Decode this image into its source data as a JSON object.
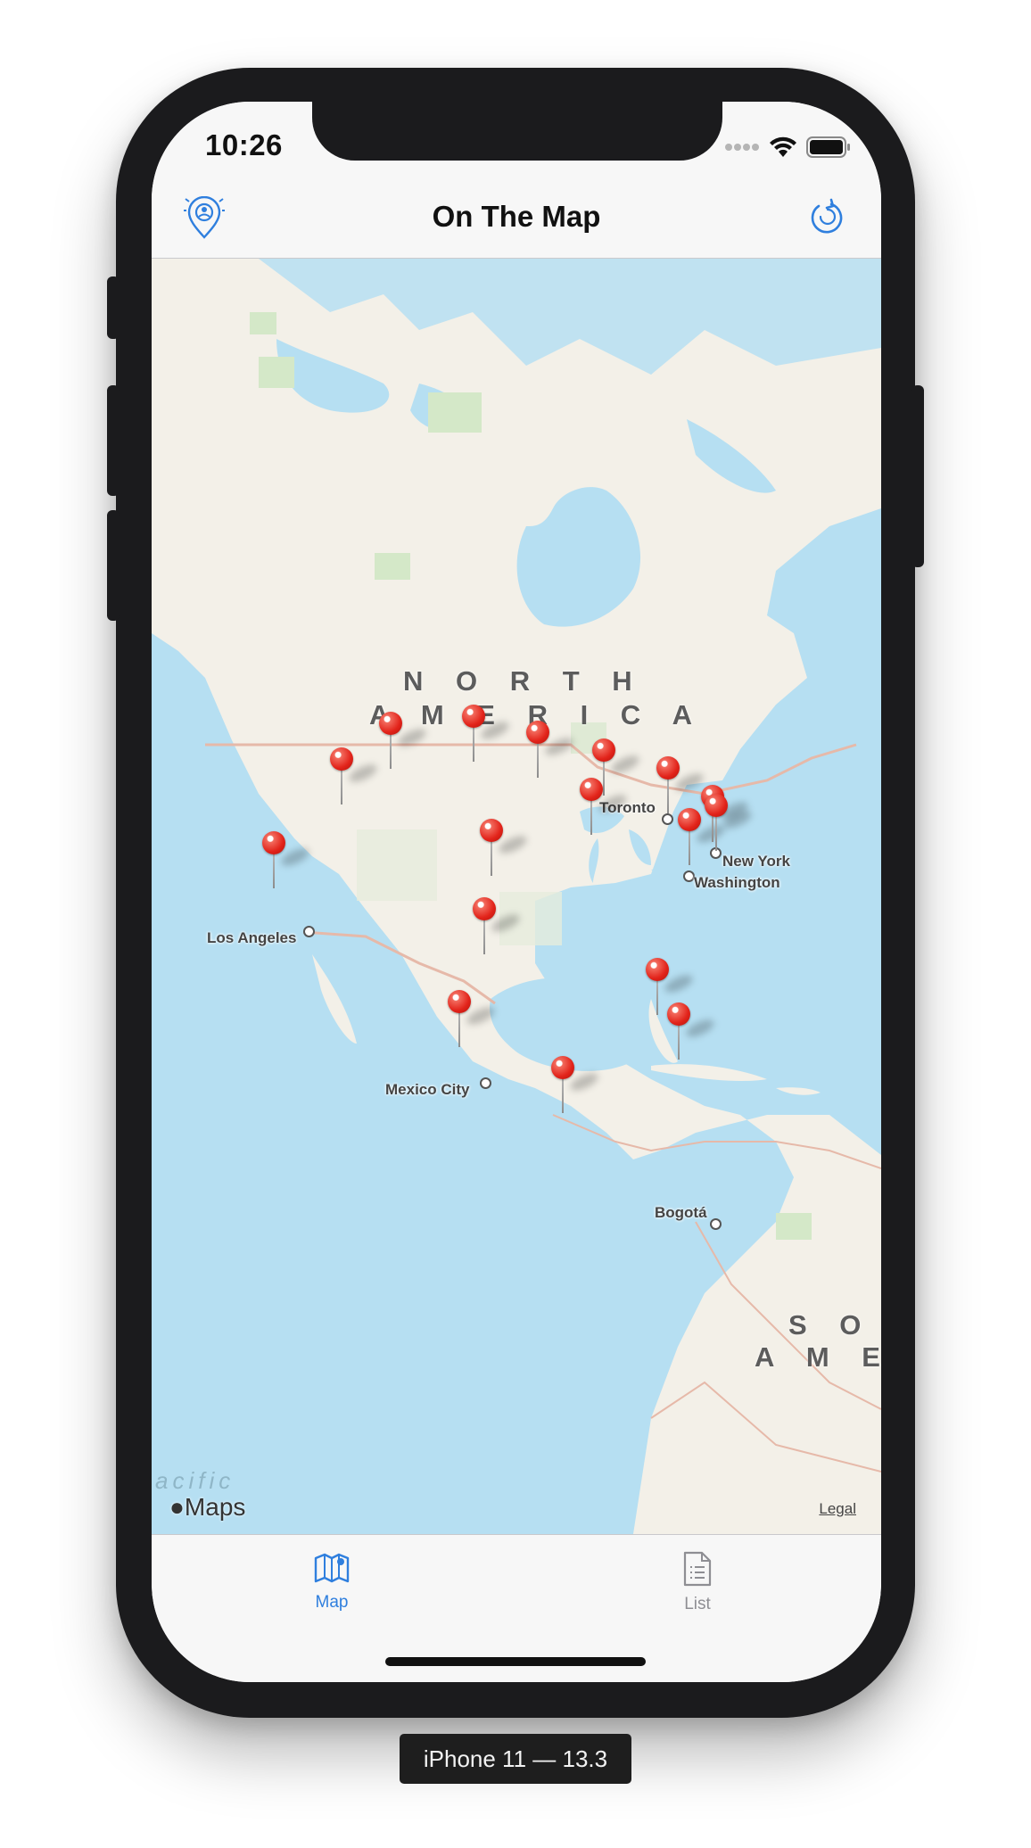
{
  "status_bar": {
    "time": "10:26"
  },
  "nav": {
    "title": "On The Map",
    "left_icon": "location-pin-icon",
    "right_icon": "refresh-icon"
  },
  "map": {
    "continent_labels": [
      "N O R T H",
      "A M E R I C A",
      "S O U",
      "A M E R"
    ],
    "cities": [
      "Toronto",
      "New York",
      "Washington",
      "Los Angeles",
      "Mexico City",
      "Bogotá"
    ],
    "ocean_label": "acific",
    "attribution": "Maps",
    "legal": "Legal",
    "pin_count": 17
  },
  "tabs": [
    {
      "label": "Map",
      "icon": "map-icon",
      "selected": true
    },
    {
      "label": "List",
      "icon": "list-document-icon",
      "selected": false
    }
  ],
  "colors": {
    "accent": "#2f7fde",
    "pin": "#e2231a",
    "water": "#b6dff2",
    "land": "#f3f0e8",
    "tab_inactive": "#8e8e93"
  },
  "device": {
    "label": "iPhone 11 — 13.3"
  }
}
